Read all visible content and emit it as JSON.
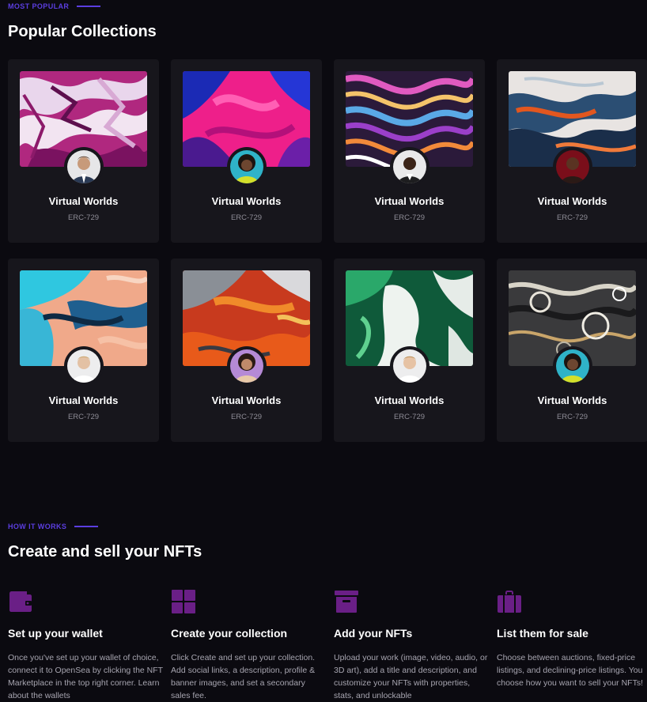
{
  "colors": {
    "accent": "#5b3ee0",
    "icon": "#6a1f86",
    "card_bg": "#17161c",
    "page_bg": "#0b0a10"
  },
  "popular": {
    "eyebrow": "MOST POPULAR",
    "title": "Popular Collections",
    "collections": [
      {
        "name": "Virtual Worlds",
        "standard": "ERC-729",
        "art": "purple-white-paint"
      },
      {
        "name": "Virtual Worlds",
        "standard": "ERC-729",
        "art": "pink-blue-paint"
      },
      {
        "name": "Virtual Worlds",
        "standard": "ERC-729",
        "art": "marble-swirl"
      },
      {
        "name": "Virtual Worlds",
        "standard": "ERC-729",
        "art": "blue-orange-fluid"
      },
      {
        "name": "Virtual Worlds",
        "standard": "ERC-729",
        "art": "cyan-peach-fluid"
      },
      {
        "name": "Virtual Worlds",
        "standard": "ERC-729",
        "art": "red-gray-texture"
      },
      {
        "name": "Virtual Worlds",
        "standard": "ERC-729",
        "art": "green-white-fluid"
      },
      {
        "name": "Virtual Worlds",
        "standard": "ERC-729",
        "art": "gray-cell-fluid"
      }
    ]
  },
  "how": {
    "eyebrow": "HOW IT WORKS",
    "title": "Create and sell your NFTs",
    "steps": [
      {
        "icon": "wallet-icon",
        "title": "Set up your wallet",
        "desc": "Once you've set up your wallet of choice, connect it to OpenSea by clicking the NFT Marketplace in the top right corner. Learn about the wallets"
      },
      {
        "icon": "grid-icon",
        "title": "Create your collection",
        "desc": "Click Create and set up your collection. Add social links, a description, profile & banner images, and set a secondary sales fee."
      },
      {
        "icon": "archive-icon",
        "title": "Add your NFTs",
        "desc": "Upload your work (image, video, audio, or 3D art), add a title and description, and customize your NFTs with properties, stats, and unlockable"
      },
      {
        "icon": "tag-icon",
        "title": "List them for sale",
        "desc": "Choose between auctions, fixed-price listings, and declining-price listings. You choose how you want to sell your NFTs!"
      }
    ]
  }
}
